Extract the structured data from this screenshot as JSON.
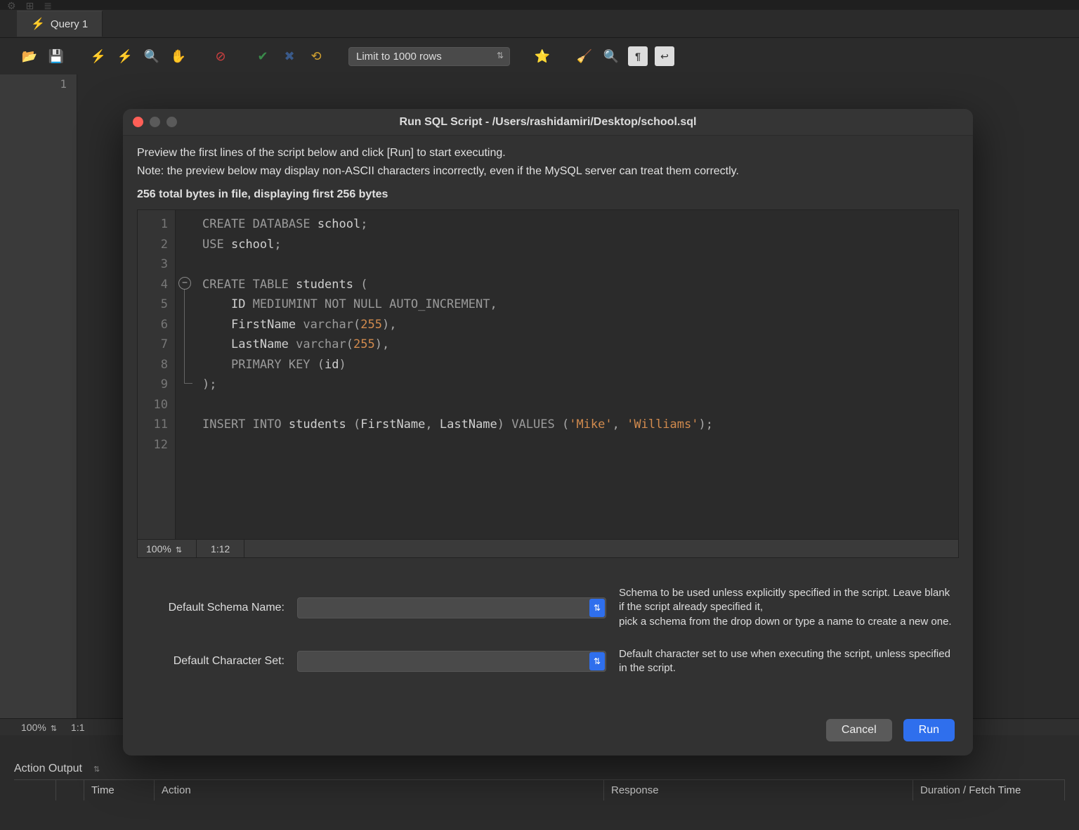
{
  "tab": {
    "label": "Query 1"
  },
  "toolbar": {
    "limit_label": "Limit to 1000 rows"
  },
  "editor_background": {
    "line1": "1",
    "zoom": "100%",
    "cursor": "1:1"
  },
  "action_output": {
    "label": "Action Output",
    "columns": {
      "time": "Time",
      "action": "Action",
      "response": "Response",
      "duration": "Duration / Fetch Time"
    }
  },
  "modal": {
    "title": "Run SQL Script - /Users/rashidamiri/Desktop/school.sql",
    "preview_line1": "Preview the first lines of the script below and click [Run] to start executing.",
    "preview_line2": "Note: the preview below may display non-ASCII characters incorrectly, even if the MySQL server can treat them correctly.",
    "bytes_line": "256 total bytes in file, displaying first 256 bytes",
    "code_status": {
      "zoom": "100%",
      "cursor": "1:12"
    },
    "form": {
      "schema_label": "Default Schema Name:",
      "schema_hint": "Schema to be used unless explicitly specified in the script. Leave blank if the script already specified it,\npick a schema from the drop down or type a name to create a new one.",
      "charset_label": "Default Character Set:",
      "charset_hint": "Default character set to use when executing the script, unless specified in the script."
    },
    "buttons": {
      "cancel": "Cancel",
      "run": "Run"
    },
    "code_lines": [
      "1",
      "2",
      "3",
      "4",
      "5",
      "6",
      "7",
      "8",
      "9",
      "10",
      "11",
      "12"
    ],
    "code": {
      "l1": {
        "kw1": "CREATE",
        "kw2": "DATABASE",
        "id": "school",
        "end": ";"
      },
      "l2": {
        "kw": "USE",
        "id": "school",
        "end": ";"
      },
      "l4": {
        "kw1": "CREATE",
        "kw2": "TABLE",
        "id": "students",
        "open": "("
      },
      "l5": {
        "id": "ID",
        "rest": "MEDIUMINT NOT NULL AUTO_INCREMENT",
        "end": ","
      },
      "l6": {
        "id": "FirstName",
        "fn": "varchar",
        "num": "255",
        "end": ","
      },
      "l7": {
        "id": "LastName",
        "fn": "varchar",
        "num": "255",
        "end": ","
      },
      "l8": {
        "kw": "PRIMARY KEY",
        "open": "(",
        "id": "id",
        "close": ")"
      },
      "l9": {
        "close": ");"
      },
      "l11": {
        "kw1": "INSERT",
        "kw2": "INTO",
        "id": "students",
        "open": "(",
        "c1": "FirstName",
        "comma": ",",
        "c2": "LastName",
        "close": ")",
        "kw3": "VALUES",
        "open2": "(",
        "s1": "'Mike'",
        "comma2": ",",
        "s2": "'Williams'",
        "close2": ");"
      }
    }
  }
}
